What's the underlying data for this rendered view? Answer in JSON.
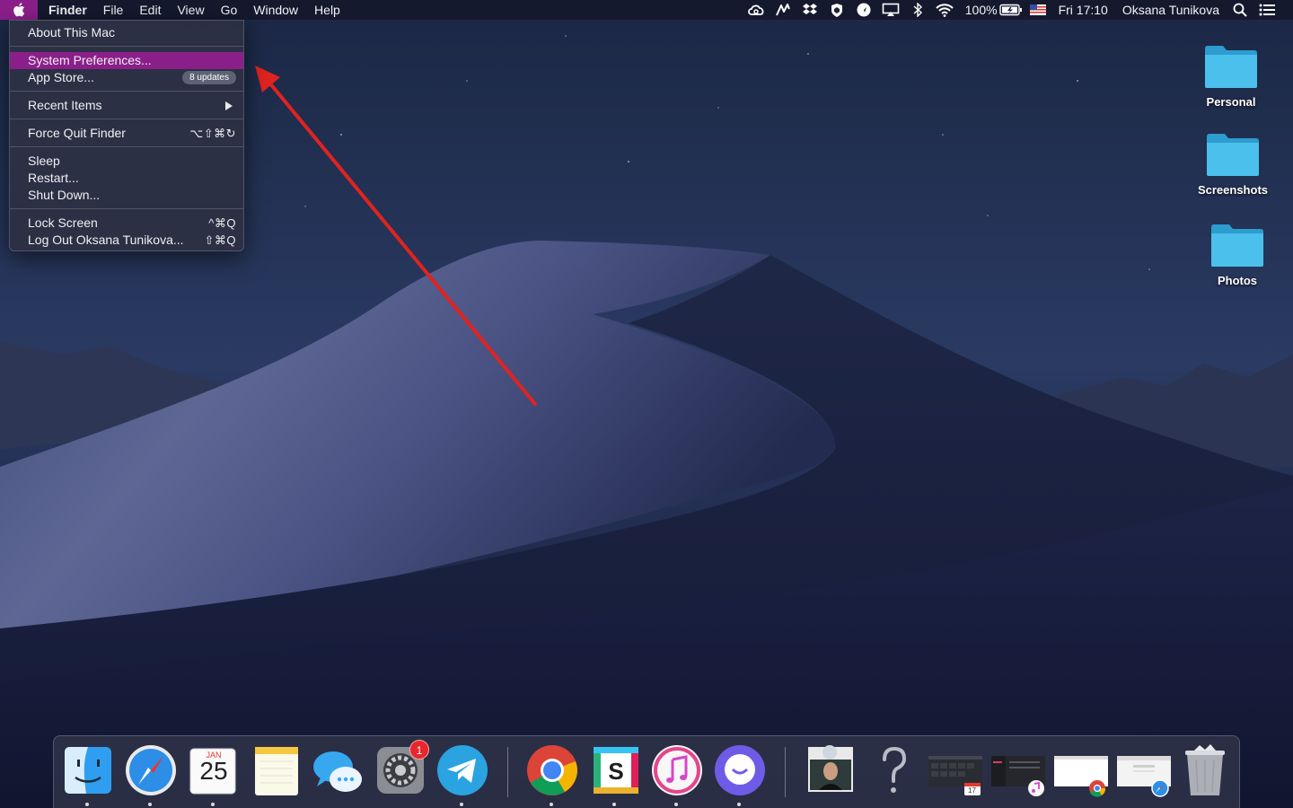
{
  "menubar": {
    "app_name": "Finder",
    "menus": [
      "File",
      "Edit",
      "View",
      "Go",
      "Window",
      "Help"
    ],
    "battery": "100%",
    "clock": "Fri 17:10",
    "user": "Oksana Tunikova"
  },
  "apple_menu": {
    "about": "About This Mac",
    "system_preferences": "System Preferences...",
    "app_store": "App Store...",
    "app_store_badge": "8 updates",
    "recent_items": "Recent Items",
    "force_quit": "Force Quit Finder",
    "force_quit_shortcut": "⌥⇧⌘↻",
    "sleep": "Sleep",
    "restart": "Restart...",
    "shut_down": "Shut Down...",
    "lock_screen": "Lock Screen",
    "lock_screen_shortcut": "^⌘Q",
    "log_out": "Log Out Oksana Tunikova...",
    "log_out_shortcut": "⇧⌘Q"
  },
  "desktop": {
    "folders": [
      "Personal",
      "Screenshots",
      "Photos"
    ]
  },
  "dock": {
    "system_preferences_badge": "1",
    "calendar_month": "JAN",
    "calendar_day": "25",
    "mini_calendar_day": "17"
  },
  "colors": {
    "highlight": "#8b1f8a",
    "annotation_arrow": "#e0231f",
    "folder_blue": "#3fb4e4"
  }
}
